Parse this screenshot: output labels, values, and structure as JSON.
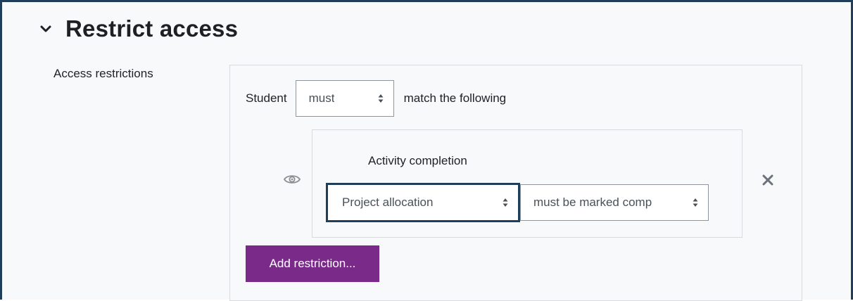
{
  "section": {
    "title": "Restrict access",
    "toggle_icon": "chevron-down-icon"
  },
  "field": {
    "label": "Access restrictions"
  },
  "restriction_set": {
    "student_label": "Student",
    "must_select_value": "must",
    "match_text": "match the following"
  },
  "condition": {
    "visibility_icon": "eye-icon",
    "type_label": "Activity completion",
    "activity_select_value": "Project allocation",
    "completion_select_value": "must be marked comp",
    "delete_icon": "close-icon"
  },
  "actions": {
    "add_restriction_label": "Add restriction..."
  },
  "colors": {
    "accent": "#1f3e5a",
    "button_bg": "#7a2b8a",
    "page_bg": "#f8f9fa",
    "border": "#d8dbde"
  }
}
